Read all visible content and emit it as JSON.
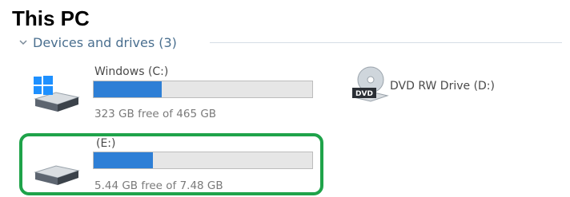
{
  "page": {
    "title": "This PC"
  },
  "group": {
    "label": "Devices and drives (3)"
  },
  "drives": [
    {
      "name": "Windows (C:)",
      "free_text": "323 GB free of 465 GB",
      "used_fraction": 0.31
    },
    {
      "name": "(E:)",
      "free_text": "5.44 GB free of 7.48 GB",
      "used_fraction": 0.27
    }
  ],
  "dvd": {
    "name": "DVD RW Drive (D:)",
    "badge": "DVD"
  },
  "colors": {
    "bar_fill": "#2e7fd6",
    "highlight": "#1fa34a",
    "group_text": "#4a6f8f"
  }
}
